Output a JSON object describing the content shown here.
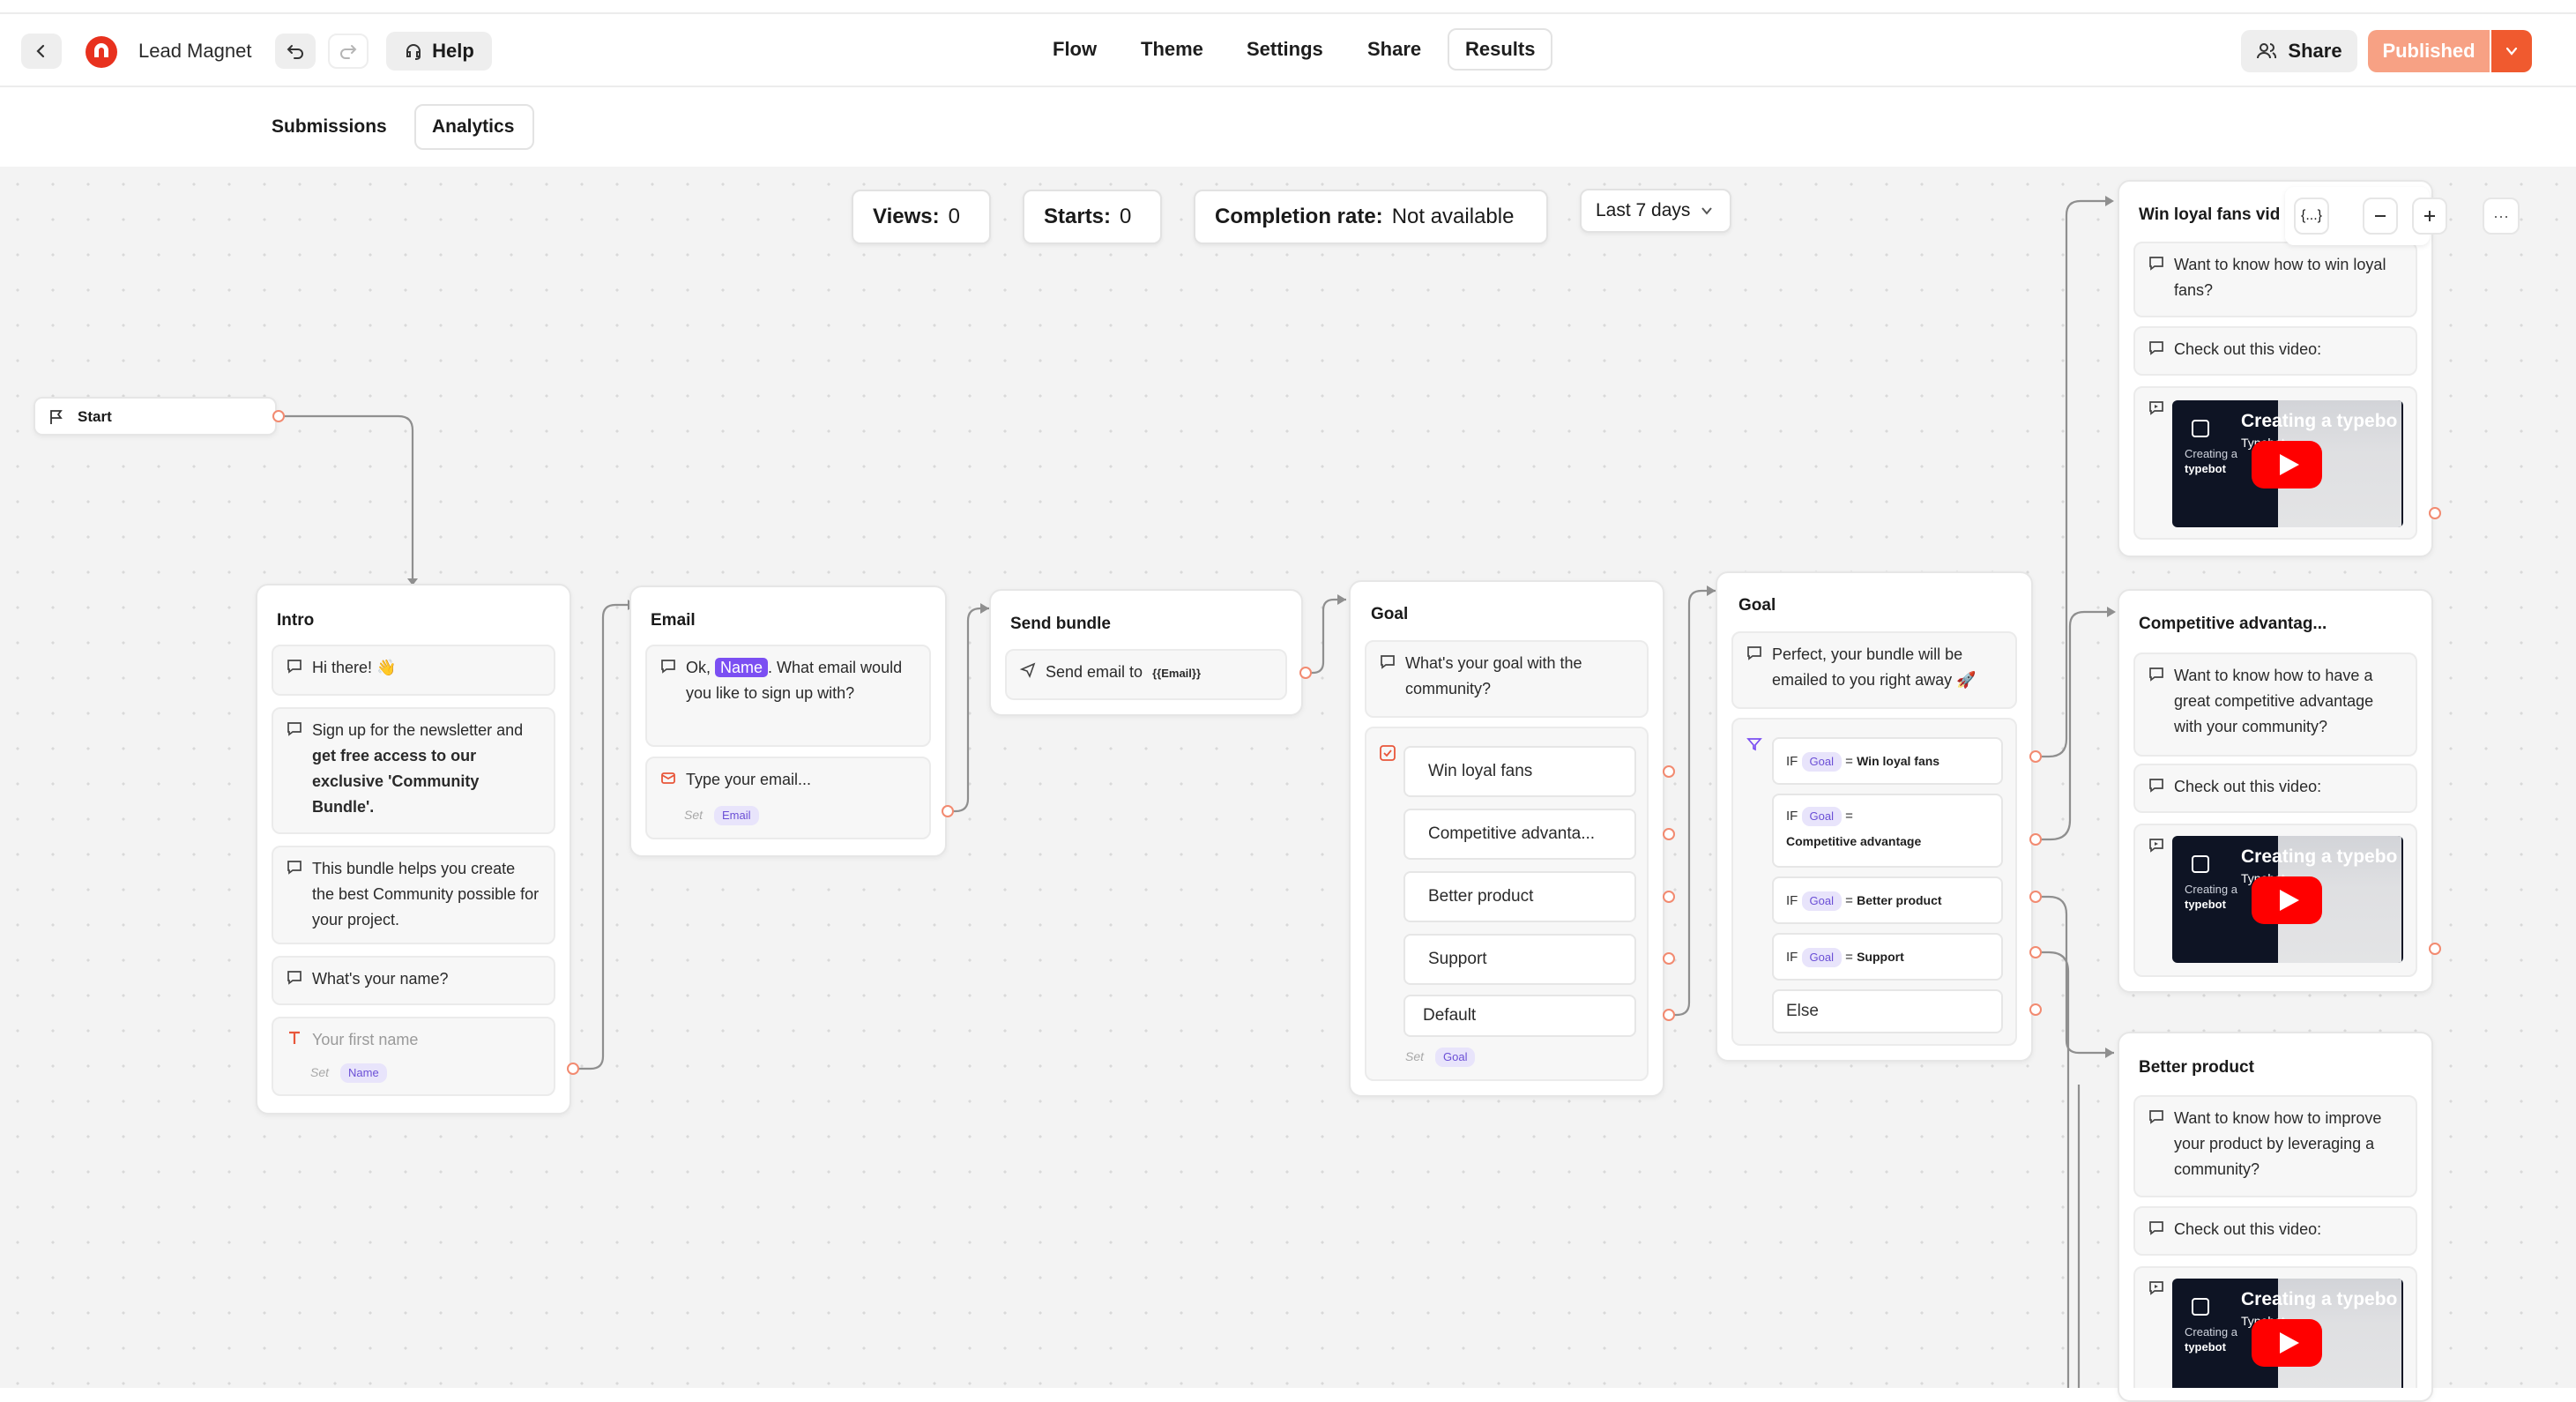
{
  "header": {
    "bot_name": "Lead Magnet",
    "help_label": "Help",
    "nav": [
      "Flow",
      "Theme",
      "Settings",
      "Share",
      "Results"
    ],
    "share_label": "Share",
    "publish_label": "Published"
  },
  "subtabs": [
    "Submissions",
    "Analytics"
  ],
  "stats": {
    "views_label": "Views:",
    "views_value": "0",
    "starts_label": "Starts:",
    "starts_value": "0",
    "completion_label": "Completion rate:",
    "completion_value": "Not available",
    "range_label": "Last 7 days"
  },
  "canvas_controls": {
    "variables_label": "{...}",
    "more_label": "···"
  },
  "start": {
    "label": "Start"
  },
  "intro": {
    "title": "Intro",
    "msg1": "Hi there! 👋",
    "msg2_a": "Sign up for the newsletter and ",
    "msg2_b": "get free access to our exclusive 'Community Bundle'.",
    "msg3": "This bundle helps you create the best Community possible for your project.",
    "msg4": "What's your name?",
    "input_placeholder": "Your first name",
    "set_label": "Set",
    "set_var": "Name"
  },
  "email": {
    "title": "Email",
    "msg_pre": "Ok, ",
    "msg_var": "Name",
    "msg_post": ". What email would you like to sign up with?",
    "input_placeholder": "Type your email...",
    "set_label": "Set",
    "set_var": "Email"
  },
  "send_bundle": {
    "title": "Send bundle",
    "action": "Send email to",
    "action_var": "{{Email}}"
  },
  "goal_choice": {
    "title": "Goal",
    "question": "What's your goal with the community?",
    "choices": [
      "Win loyal fans",
      "Competitive advanta...",
      "Better product",
      "Support",
      "Default"
    ],
    "set_label": "Set",
    "set_var": "Goal"
  },
  "goal_cond": {
    "title": "Goal",
    "msg": "Perfect, your bundle will be emailed to you right away 🚀",
    "if_label": "IF",
    "var": "Goal",
    "eq": "=",
    "conditions": [
      "Win loyal fans",
      "Competitive advantage",
      "Better product",
      "Support"
    ],
    "else_label": "Else"
  },
  "fans": {
    "title": "Win loyal fans vid",
    "msg1": "Want to know how to win loyal fans?",
    "msg2": "Check out this video:"
  },
  "competitive": {
    "title": "Competitive advantag...",
    "msg1": "Want to know how to have a great competitive advantage with your community?",
    "msg2": "Check out this video:"
  },
  "better": {
    "title": "Better product",
    "msg1": "Want to know how to improve your product by leveraging a community?",
    "msg2": "Check out this video:"
  },
  "video": {
    "title": "Creating a typebo",
    "channel": "Typebot",
    "left_text_a": "Creating a",
    "left_text_b": "typebot"
  }
}
